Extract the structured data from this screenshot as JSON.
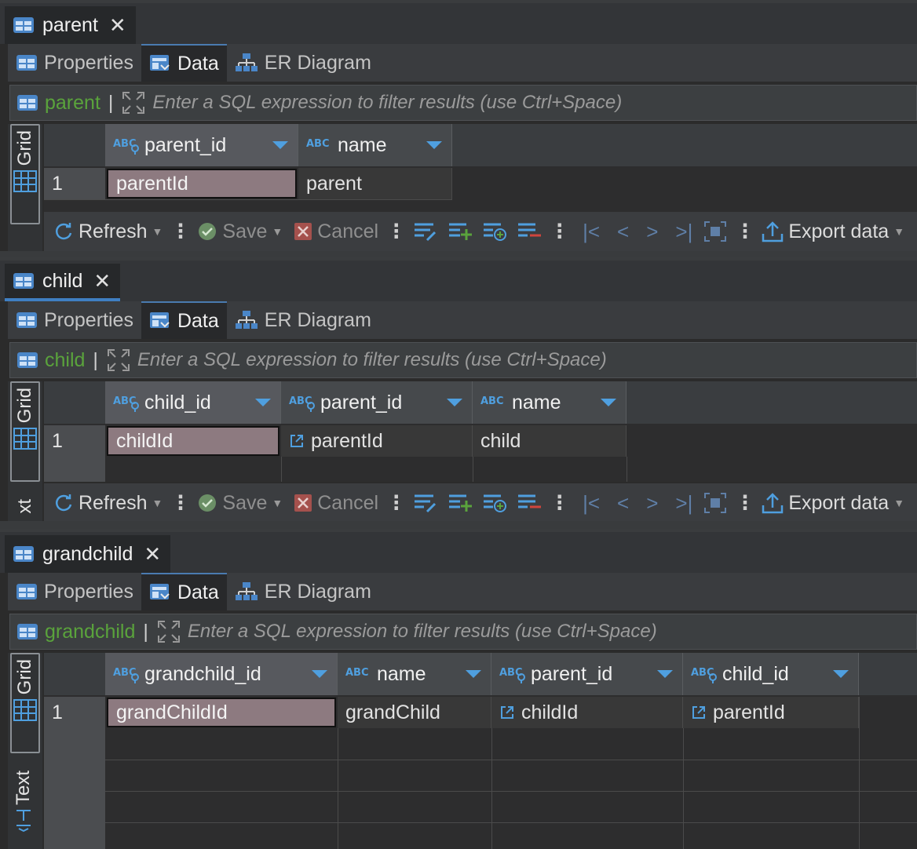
{
  "toolbar": {
    "refresh": "Refresh",
    "save": "Save",
    "cancel": "Cancel",
    "export": "Export data"
  },
  "vtabs": {
    "grid": "Grid",
    "text": "Text",
    "text_partial": "xt"
  },
  "subtabs": {
    "properties": "Properties",
    "data": "Data",
    "er": "ER Diagram"
  },
  "filter_placeholder": "Enter a SQL expression to filter results (use Ctrl+Space)",
  "panels": [
    {
      "tab_title": "parent",
      "entity": "parent",
      "columns": [
        {
          "name": "parent_id",
          "type_icon": "abc-key-icon"
        },
        {
          "name": "name",
          "type_icon": "abc-icon"
        }
      ],
      "rows": [
        {
          "num": "1",
          "cells": [
            "parentId",
            "parent"
          ]
        }
      ]
    },
    {
      "tab_title": "child",
      "entity": "child",
      "columns": [
        {
          "name": "child_id",
          "type_icon": "abc-key-icon"
        },
        {
          "name": "parent_id",
          "type_icon": "abc-key-icon"
        },
        {
          "name": "name",
          "type_icon": "abc-icon"
        }
      ],
      "rows": [
        {
          "num": "1",
          "cells": [
            "childId",
            "parentId",
            "child"
          ]
        }
      ]
    },
    {
      "tab_title": "grandchild",
      "entity": "grandchild",
      "columns": [
        {
          "name": "grandchild_id",
          "type_icon": "abc-key-icon"
        },
        {
          "name": "name",
          "type_icon": "abc-icon"
        },
        {
          "name": "parent_id",
          "type_icon": "abc-key-icon"
        },
        {
          "name": "child_id",
          "type_icon": "abc-key-icon"
        }
      ],
      "rows": [
        {
          "num": "1",
          "cells": [
            "grandChildId",
            "grandChild",
            "childId",
            "parentId"
          ]
        }
      ]
    }
  ],
  "colors": {
    "accent_blue": "#4f9fdf",
    "entity_green": "#5aa33c",
    "pk_cell": "#8d7a80"
  }
}
